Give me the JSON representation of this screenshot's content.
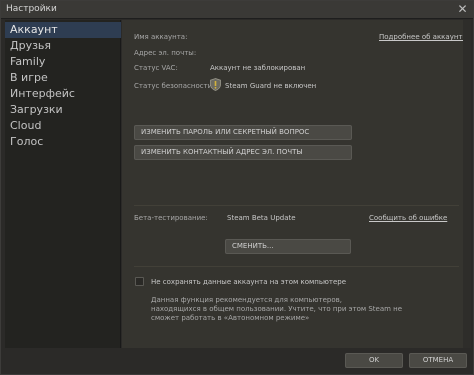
{
  "window": {
    "title": "Настройки",
    "close_glyph": "✕"
  },
  "sidebar": {
    "items": [
      {
        "label": "Аккаунт",
        "active": true
      },
      {
        "label": "Друзья",
        "active": false
      },
      {
        "label": "Family",
        "active": false
      },
      {
        "label": "В игре",
        "active": false
      },
      {
        "label": "Интерфейс",
        "active": false
      },
      {
        "label": "Загрузки",
        "active": false
      },
      {
        "label": "Cloud",
        "active": false
      },
      {
        "label": "Голос",
        "active": false
      }
    ]
  },
  "account": {
    "name_label": "Имя аккаунта:",
    "more_link": "Подробнее об аккаунте",
    "email_label": "Адрес эл. почты:",
    "vac_label": "Статус VAC:",
    "vac_value": "Аккаунт не заблокирован",
    "security_label": "Статус безопасности:",
    "security_value": "Steam Guard не включен",
    "change_password_button": "ИЗМЕНИТЬ ПАРОЛЬ ИЛИ СЕКРЕТНЫЙ ВОПРОС",
    "change_email_button": "ИЗМЕНИТЬ КОНТАКТНЫЙ АДРЕС ЭЛ. ПОЧТЫ"
  },
  "beta": {
    "label": "Бета-тестирование:",
    "value": "Steam Beta Update",
    "report_link": "Сообщить об ошибке",
    "change_button": "СМЕНИТЬ..."
  },
  "remember": {
    "checkbox_label": "Не сохранять данные аккаунта на этом компьютере",
    "note_line1": "Данная функция рекомендуется для компьютеров,",
    "note_line2": "находящихся в общем пользовании. Учтите, что при этом Steam не",
    "note_line3": "сможет работать в «Автономном режиме»",
    "checked": false
  },
  "footer": {
    "ok_button": "OK",
    "cancel_button": "ОТМЕНА"
  },
  "colors": {
    "accent_selected": "#2e3d52",
    "shield_yellow": "#d4b23c"
  }
}
